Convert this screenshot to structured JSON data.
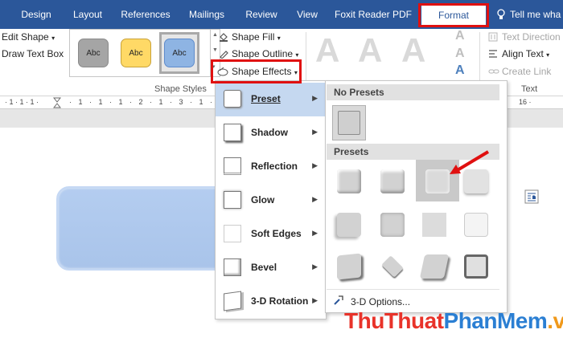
{
  "tabs": [
    {
      "label": "Design"
    },
    {
      "label": "Layout"
    },
    {
      "label": "References"
    },
    {
      "label": "Mailings"
    },
    {
      "label": "Review"
    },
    {
      "label": "View"
    },
    {
      "label": "Foxit Reader PDF"
    },
    {
      "label": "Format"
    },
    {
      "label": "Tell me wha"
    }
  ],
  "ribbon": {
    "edit_shape": "Edit Shape",
    "draw_text_box": "Draw Text Box",
    "style_swatches": [
      "Abc",
      "Abc",
      "Abc"
    ],
    "shape_fill": "Shape Fill",
    "shape_outline": "Shape Outline",
    "shape_effects": "Shape Effects",
    "group_shape_styles": "Shape Styles",
    "text_direction": "Text Direction",
    "align_text": "Align Text",
    "create_link": "Create Link",
    "group_text": "Text",
    "wordart_letter": "A",
    "colors": {
      "gray": "#a5a5a5",
      "gold": "#ffd966",
      "blue": "#8eb4e3"
    }
  },
  "ruler": {
    "left_ticks": "· 1 · 1 · 1 · 2 · 1 · 3 · 1 · 4 ·",
    "right_number": "16"
  },
  "effects_menu": {
    "items": [
      {
        "label": "Preset",
        "active": true
      },
      {
        "label": "Shadow"
      },
      {
        "label": "Reflection"
      },
      {
        "label": "Glow"
      },
      {
        "label": "Soft Edges"
      },
      {
        "label": "Bevel"
      },
      {
        "label": "3-D Rotation"
      }
    ]
  },
  "preset_submenu": {
    "no_presets_header": "No Presets",
    "presets_header": "Presets",
    "options_label": "3-D Options..."
  },
  "watermark": {
    "part1": "Thu",
    "part2": "Thuat",
    "part3": "PhanMem",
    "part4": ".vn"
  },
  "colors": {
    "accent": "#2b579a",
    "highlight_red": "#e01010",
    "shape_fill": "#aac5eb"
  }
}
